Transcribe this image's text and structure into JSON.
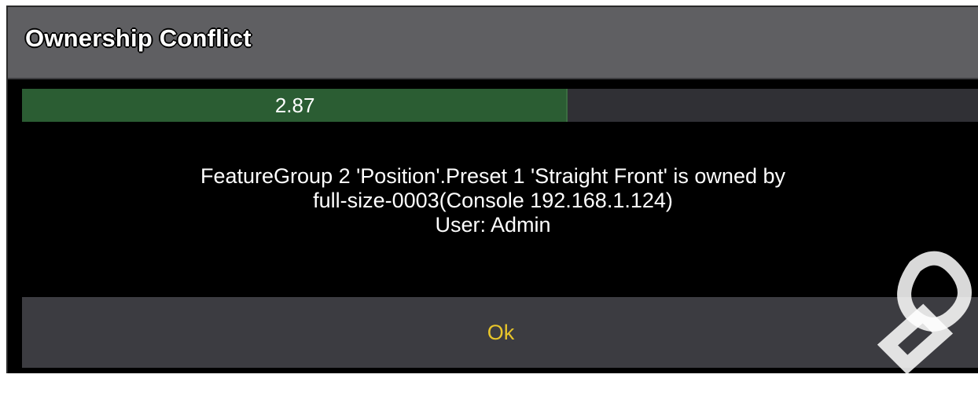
{
  "dialog": {
    "title": "Ownership Conflict",
    "progress": {
      "value_label": "2.87",
      "fill_fraction": 0.57
    },
    "message_lines": [
      "FeatureGroup 2 'Position'.Preset 1 'Straight Front' is owned by",
      "full-size-0003(Console 192.168.1.124)",
      "User: Admin"
    ],
    "ok_label": "Ok"
  },
  "colors": {
    "title_bar": "#5f5f62",
    "progress_fill": "#2b5d33",
    "progress_track": "#303035",
    "button_bg": "#3c3c41",
    "button_text": "#e8c52a"
  }
}
